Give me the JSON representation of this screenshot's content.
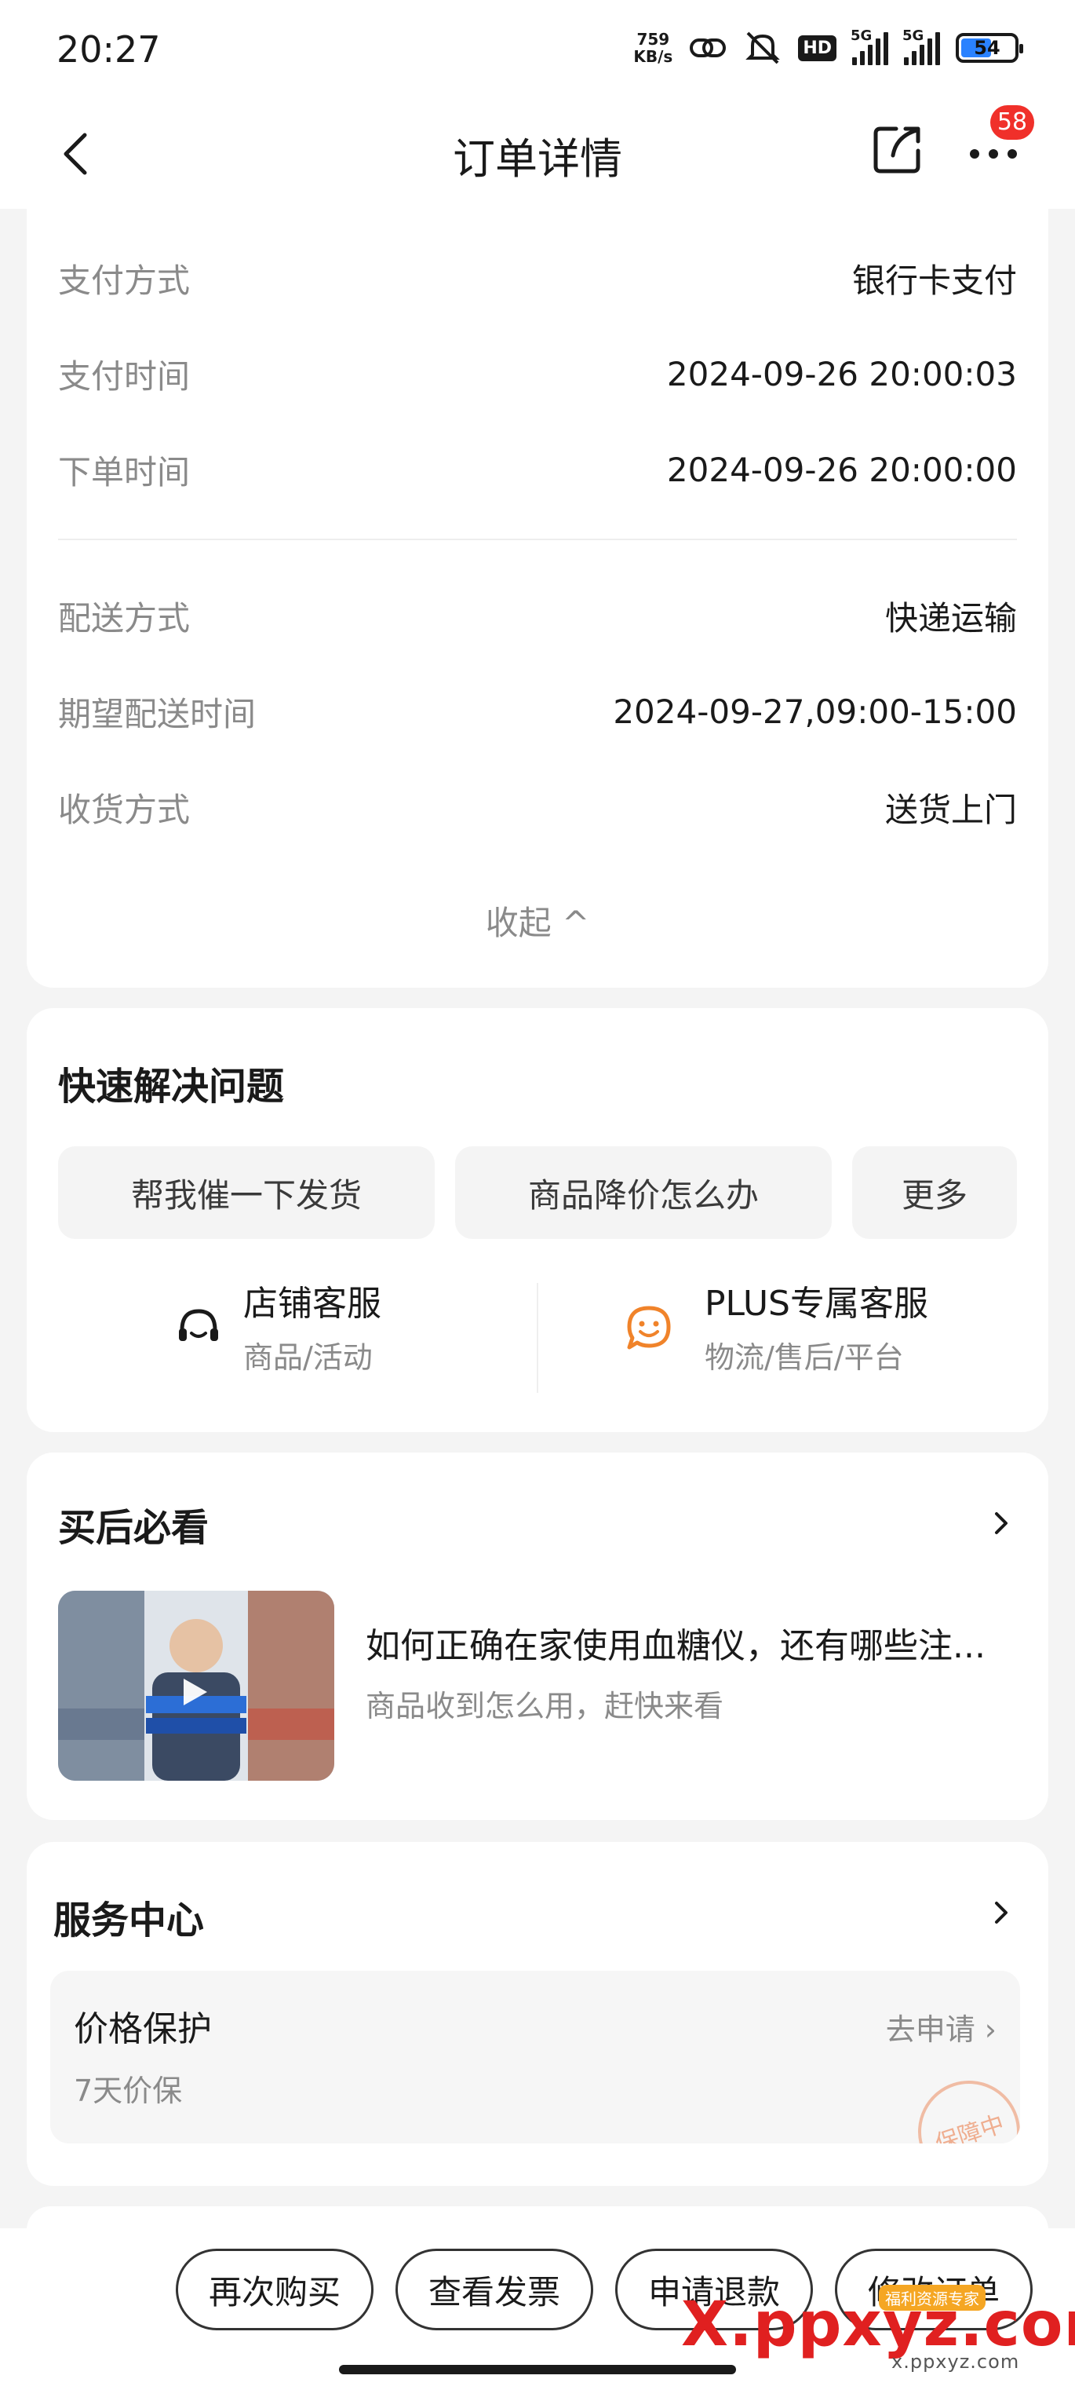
{
  "status_bar": {
    "time": "20:27",
    "speed_value": "759",
    "speed_unit": "KB/s",
    "network1": "5G",
    "network2": "5G",
    "hd_label": "HD",
    "battery": "54"
  },
  "nav": {
    "title": "订单详情",
    "badge": "58"
  },
  "order_info": {
    "rows1": [
      {
        "key": "支付方式",
        "value": "银行卡支付"
      },
      {
        "key": "支付时间",
        "value": "2024-09-26 20:00:03"
      },
      {
        "key": "下单时间",
        "value": "2024-09-26 20:00:00"
      }
    ],
    "rows2": [
      {
        "key": "配送方式",
        "value": "快递运输"
      },
      {
        "key": "期望配送时间",
        "value": "2024-09-27,09:00-15:00"
      },
      {
        "key": "收货方式",
        "value": "送货上门"
      }
    ],
    "collapse_label": "收起 ^"
  },
  "quick": {
    "title": "快速解决问题",
    "chips": [
      "帮我催一下发货",
      "商品降价怎么办",
      "更多"
    ],
    "store_cs": {
      "name": "店铺客服",
      "sub": "商品/活动"
    },
    "plus_cs": {
      "name": "PLUS专属客服",
      "sub": "物流/售后/平台"
    }
  },
  "must_see": {
    "title": "买后必看",
    "video_title": "如何正确在家使用血糖仪，还有哪些注...",
    "video_sub": "商品收到怎么用，赶快来看"
  },
  "service": {
    "title": "服务中心",
    "item_title": "价格保护",
    "item_sub": "7天价保",
    "item_link": "去申请 ›",
    "stamp": "保障中"
  },
  "bottom": {
    "buttons": [
      "再次购买",
      "查看发票",
      "申请退款",
      "修改订单"
    ]
  },
  "watermark": {
    "text": "X.ppxyz.com",
    "sub": "x.ppxyz.com",
    "tag": "福利资源专家"
  },
  "colors": {
    "accent_orange": "#f0832a",
    "badge_red": "#f0302a",
    "text_primary": "#1a1a1a",
    "text_secondary": "#8a8a8a"
  }
}
